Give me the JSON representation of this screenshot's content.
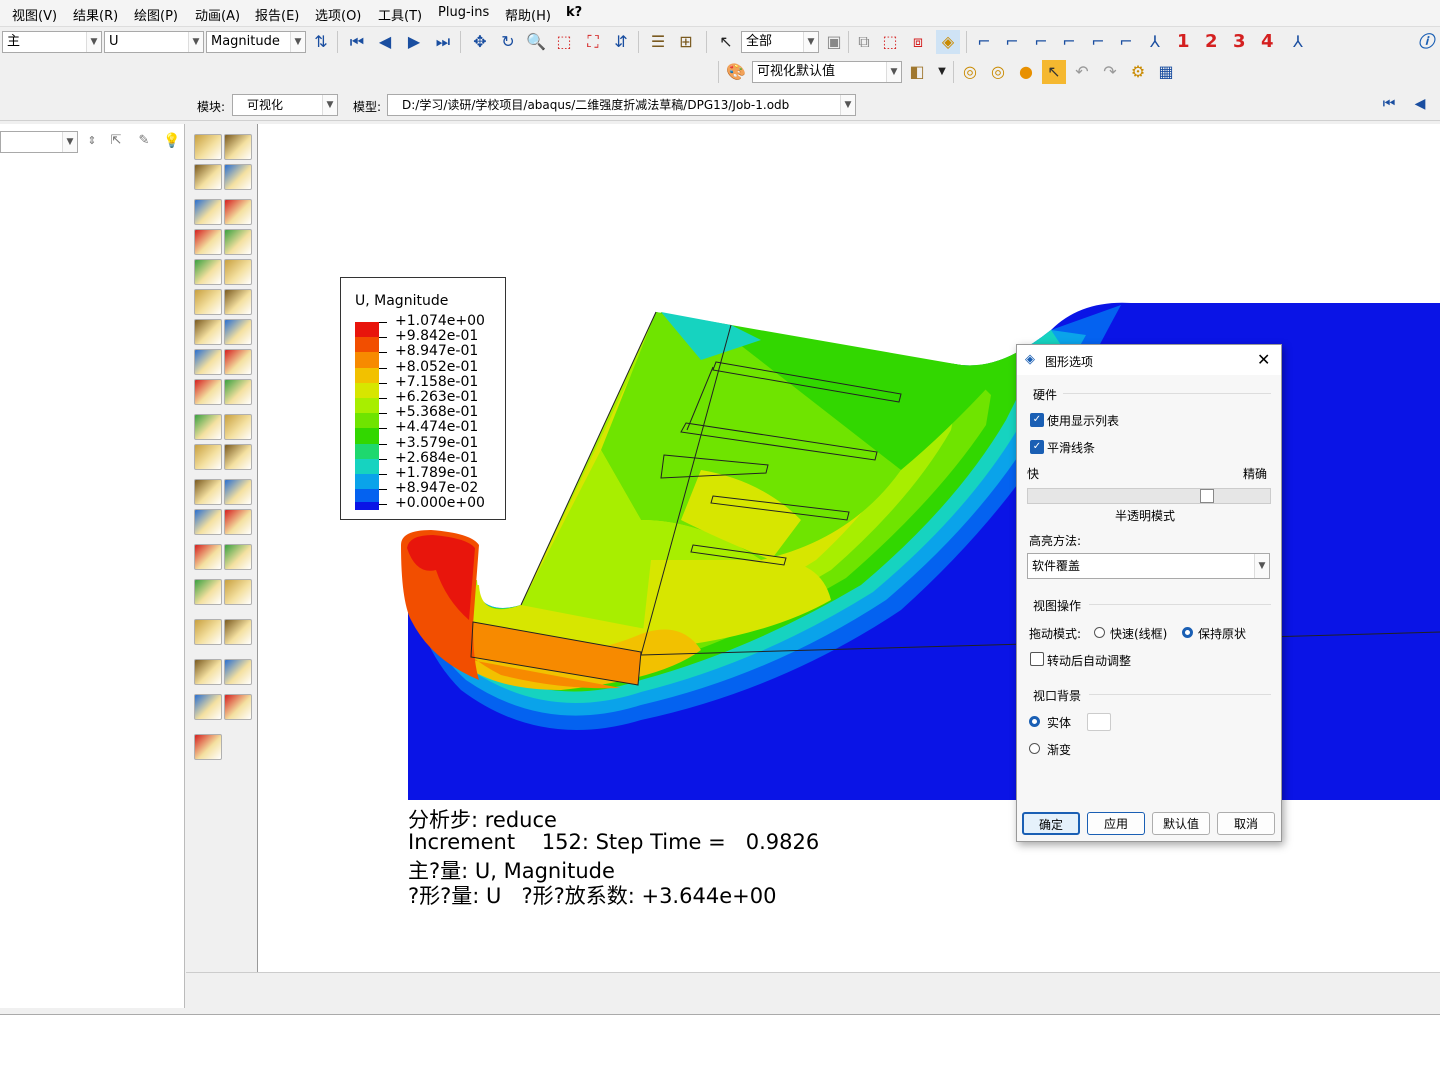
{
  "menu": [
    "视图(V)",
    "结果(R)",
    "绘图(P)",
    "动画(A)",
    "报告(E)",
    "选项(O)",
    "工具(T)",
    "Plug-ins",
    "帮助(H)",
    "k?"
  ],
  "toolbar": {
    "variable_type": "主",
    "field": "U",
    "invariant": "Magnitude",
    "selection_filter": "全部",
    "view_defaults": "可视化默认值",
    "view_numbers": [
      "1",
      "2",
      "3",
      "4"
    ]
  },
  "context": {
    "module_label": "模块:",
    "module": "可视化",
    "model_label": "模型:",
    "model_path": "D:/学习/读研/学校项目/abaqus/二维强度折减法草稿/DPG13/Job-1.odb"
  },
  "legend": {
    "title": "U, Magnitude",
    "values": [
      "+1.074e+00",
      "+9.842e-01",
      "+8.947e-01",
      "+8.052e-01",
      "+7.158e-01",
      "+6.263e-01",
      "+5.368e-01",
      "+4.474e-01",
      "+3.579e-01",
      "+2.684e-01",
      "+1.789e-01",
      "+8.947e-02",
      "+0.000e+00"
    ],
    "colors": [
      "#e8150c",
      "#f24e00",
      "#f78a00",
      "#f2c100",
      "#d7e600",
      "#a8ee00",
      "#6fe400",
      "#32d700",
      "#1ed86e",
      "#16d3c0",
      "#0aa3ea",
      "#0462f0",
      "#0a14e6"
    ]
  },
  "info": {
    "step": "分析步: reduce",
    "increment": "Increment    152: Step Time =   0.9826",
    "primary": "主?量: U, Magnitude",
    "deformed": "?形?量: U   ?形?放系数: +3.644e+00"
  },
  "dialog": {
    "title": "图形选项",
    "hardware_group": "硬件",
    "use_display_list": "使用显示列表",
    "smooth_lines": "平滑线条",
    "slider_left": "快",
    "slider_right": "精确",
    "translucency_mode": "半透明模式",
    "highlight_label": "高亮方法:",
    "highlight_value": "软件覆盖",
    "view_ops_group": "视图操作",
    "drag_mode_label": "拖动模式:",
    "drag_fast": "快速(线框)",
    "drag_keep": "保持原状",
    "auto_fit": "转动后自动调整",
    "bg_group": "视口背景",
    "bg_solid": "实体",
    "bg_gradient": "渐变",
    "btn_ok": "确定",
    "btn_apply": "应用",
    "btn_defaults": "默认值",
    "btn_cancel": "取消"
  }
}
